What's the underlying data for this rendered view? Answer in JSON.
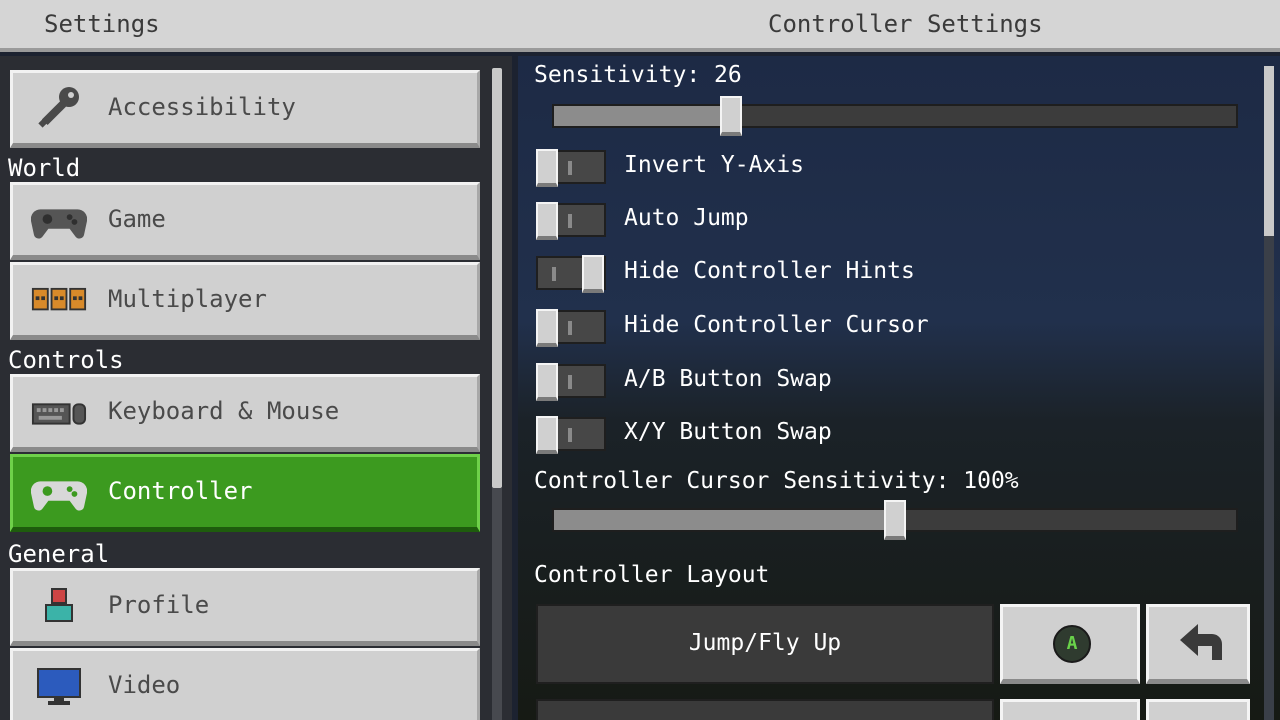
{
  "header": {
    "left_title": "Settings",
    "right_title": "Controller Settings"
  },
  "sidebar": {
    "sections": {
      "world": "World",
      "controls": "Controls",
      "general": "General"
    },
    "items": [
      {
        "label": "Accessibility",
        "icon": "key-icon"
      },
      {
        "label": "Game",
        "icon": "gamepad-icon"
      },
      {
        "label": "Multiplayer",
        "icon": "players-icon"
      },
      {
        "label": "Keyboard & Mouse",
        "icon": "keyboard-mouse-icon"
      },
      {
        "label": "Controller",
        "icon": "gamepad-icon",
        "active": true
      },
      {
        "label": "Profile",
        "icon": "profile-icon"
      },
      {
        "label": "Video",
        "icon": "monitor-icon"
      }
    ]
  },
  "controller": {
    "sensitivity_label": "Sensitivity: 26",
    "sensitivity_value": 26,
    "sensitivity_fraction": 0.26,
    "toggles": [
      {
        "label": "Invert Y-Axis",
        "on": false
      },
      {
        "label": "Auto Jump",
        "on": false
      },
      {
        "label": "Hide Controller Hints",
        "on": true
      },
      {
        "label": "Hide Controller Cursor",
        "on": false
      },
      {
        "label": "A/B Button Swap",
        "on": false
      },
      {
        "label": "X/Y Button Swap",
        "on": false
      }
    ],
    "cursor_sensitivity_label": "Controller Cursor Sensitivity: 100%",
    "cursor_sensitivity_fraction": 0.5,
    "layout_title": "Controller Layout",
    "layout_rows": [
      {
        "action": "Jump/Fly Up",
        "button": "A"
      }
    ]
  },
  "colors": {
    "accent": "#3c9a1f",
    "button_bg": "#d0d0d0",
    "panel_bg": "#2b2d33"
  }
}
